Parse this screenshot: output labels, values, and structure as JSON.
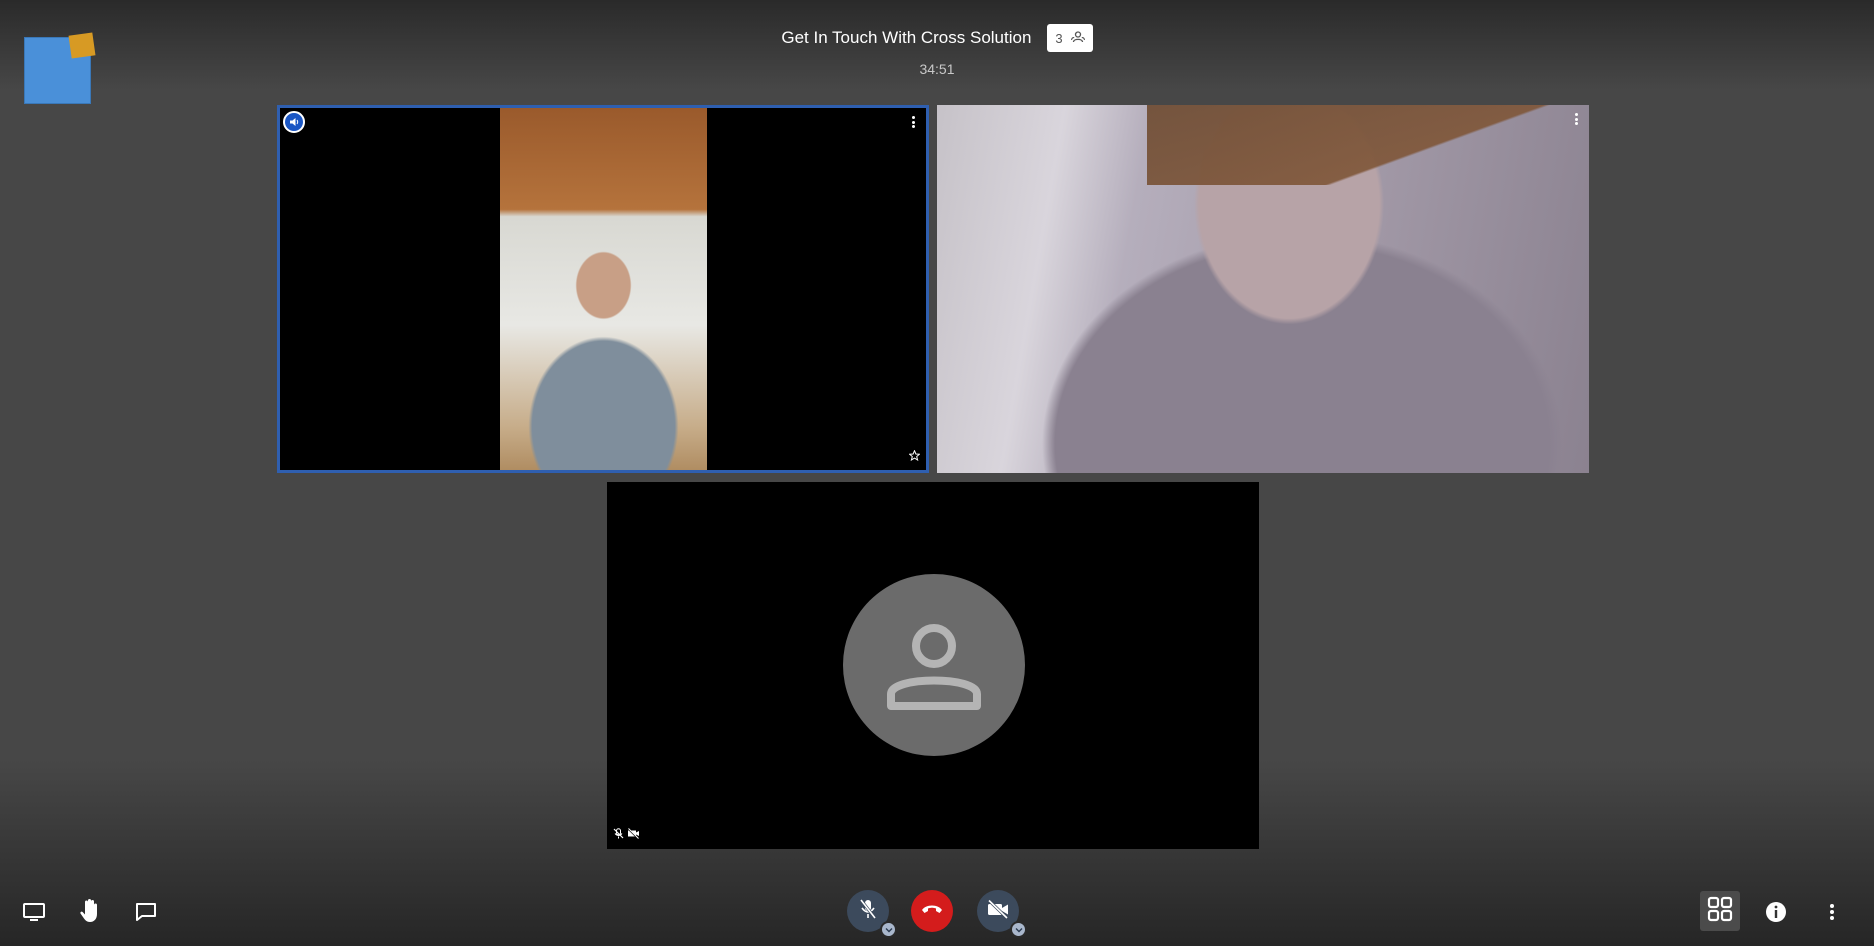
{
  "meeting": {
    "title": "Get In Touch With Cross Solution",
    "participant_count": "3",
    "elapsed": "34:51"
  },
  "icons": {
    "logo": "app-logo",
    "participants": "participants-icon",
    "speaker": "dominant-speaker-icon",
    "more": "more-options-icon",
    "pin": "star-icon",
    "mic_off": "mic-off-icon",
    "cam_off": "camera-off-icon",
    "avatar": "person-avatar-icon",
    "screen_share": "screen-share-icon",
    "raise_hand": "raise-hand-icon",
    "chat": "chat-icon",
    "hangup": "hangup-icon",
    "tile_view": "tile-view-icon",
    "info": "info-icon",
    "overflow": "overflow-menu-icon"
  },
  "colors": {
    "accent_border": "#2f5fb0",
    "hangup": "#d41c1c",
    "logo_blue": "#4a90d9",
    "logo_orange": "#d79a24"
  },
  "participants": [
    {
      "video": "on",
      "dominant_speaker": true
    },
    {
      "video": "on",
      "dominant_speaker": false
    },
    {
      "video": "off",
      "audio": "muted"
    }
  ],
  "controls": {
    "microphone": "muted",
    "camera": "off"
  }
}
